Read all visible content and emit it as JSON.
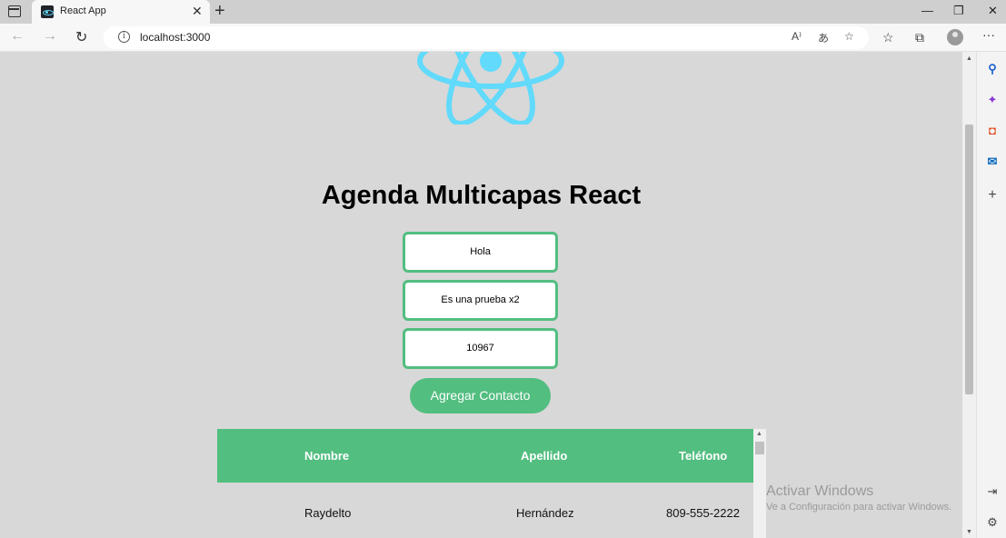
{
  "browser": {
    "tab_title": "React App",
    "tab_close": "✕",
    "new_tab": "+",
    "url": "localhost:3000",
    "window_controls": {
      "minimize": "—",
      "restore": "❐",
      "close": "✕"
    },
    "read_aloud": "A⁾",
    "translate": "あ",
    "more": "···"
  },
  "page": {
    "title": "Agenda Multicapas React",
    "inputs": {
      "nombre": "Hola",
      "apellido": "Es una prueba x2",
      "telefono": "10967"
    },
    "add_button": "Agregar Contacto",
    "table": {
      "headers": [
        "Nombre",
        "Apellido",
        "Teléfono"
      ],
      "rows": [
        [
          "Raydelto",
          "Hernández",
          "809-555-2222"
        ]
      ]
    }
  },
  "watermark": {
    "line1": "Activar Windows",
    "line2": "Ve a Configuración para activar Windows."
  },
  "colors": {
    "accent": "#52be80",
    "react_logo": "#61dafb",
    "page_bg": "#d8d8d8"
  }
}
